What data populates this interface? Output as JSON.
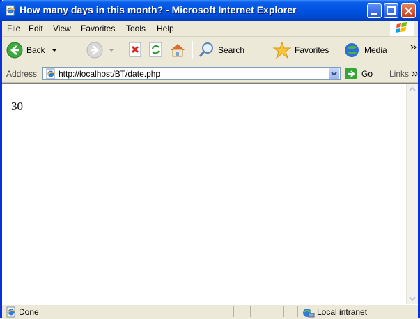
{
  "window": {
    "title": "How many days in this month? - Microsoft Internet Explorer"
  },
  "menubar": {
    "items": [
      {
        "label": "File"
      },
      {
        "label": "Edit"
      },
      {
        "label": "View"
      },
      {
        "label": "Favorites"
      },
      {
        "label": "Tools"
      },
      {
        "label": "Help"
      }
    ]
  },
  "toolbar": {
    "back_label": "Back",
    "search_label": "Search",
    "favorites_label": "Favorites",
    "media_label": "Media"
  },
  "addressbar": {
    "label": "Address",
    "url": "http://localhost/BT/date.php",
    "go_label": "Go",
    "links_label": "Links"
  },
  "content": {
    "text": "30"
  },
  "statusbar": {
    "status": "Done",
    "zone": "Local intranet"
  },
  "colors": {
    "titlebar": "#0054E3",
    "accent": "#0A5EE8"
  }
}
